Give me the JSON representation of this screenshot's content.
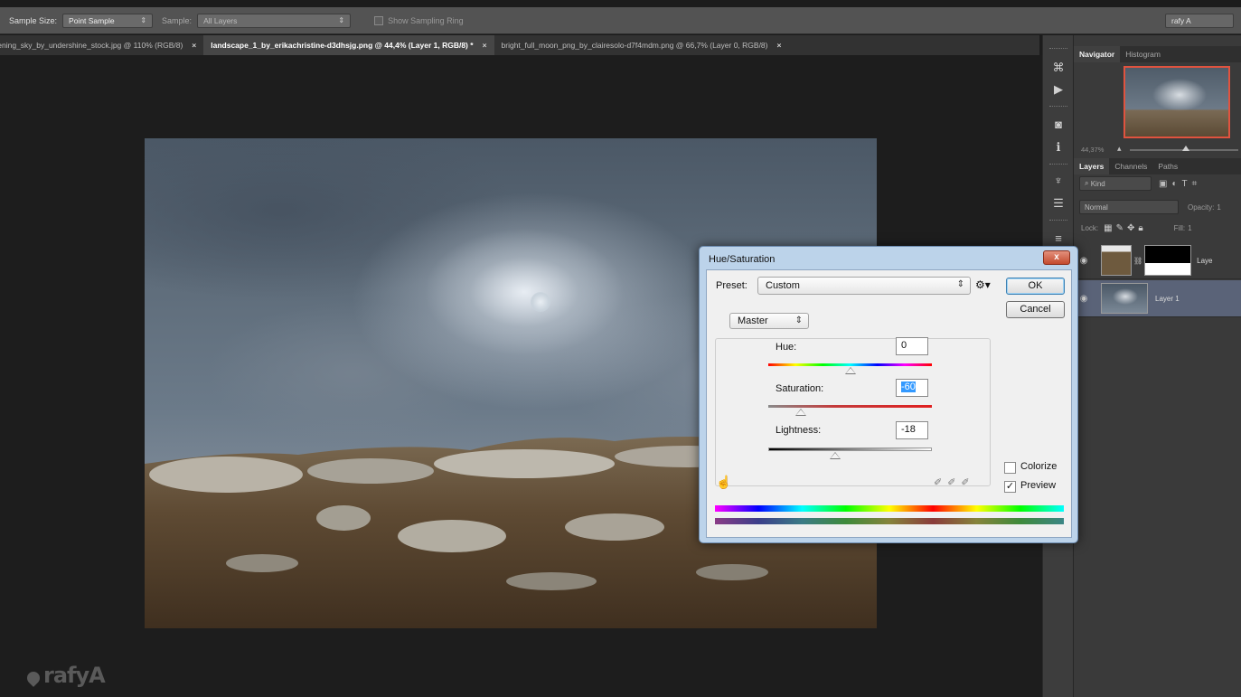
{
  "options_bar": {
    "sample_size_label": "Sample Size:",
    "sample_size_value": "Point Sample",
    "sample_label": "Sample:",
    "sample_value": "All Layers",
    "show_sampling_ring": "Show Sampling Ring",
    "user": "rafy A"
  },
  "tabs": [
    {
      "label": "vening_sky_by_undershine_stock.jpg @ 110% (RGB/8)",
      "close": "×"
    },
    {
      "label": "landscape_1_by_erikachristine-d3dhsjg.png @ 44,4% (Layer 1, RGB/8) *",
      "close": "×"
    },
    {
      "label": "bright_full_moon_png_by_clairesolo-d7f4mdm.png @ 66,7% (Layer 0, RGB/8)",
      "close": "×"
    }
  ],
  "watermark": "rafyA",
  "panels": {
    "navigator_tabs": [
      "Navigator",
      "Histogram"
    ],
    "zoom": "44,37%",
    "layers_tabs": [
      "Layers",
      "Channels",
      "Paths"
    ],
    "kind": "Kind",
    "blend_mode": "Normal",
    "opacity_label": "Opacity:",
    "opacity_value": "1",
    "lock_label": "Lock:",
    "fill_label": "Fill:",
    "fill_value": "1",
    "layers": [
      {
        "name": "Laye"
      },
      {
        "name": "Layer 1"
      }
    ]
  },
  "dialog": {
    "title": "Hue/Saturation",
    "close": "x",
    "preset_label": "Preset:",
    "preset_value": "Custom",
    "ok": "OK",
    "cancel": "Cancel",
    "channel": "Master",
    "hue_label": "Hue:",
    "hue_value": "0",
    "saturation_label": "Saturation:",
    "saturation_value": "-60",
    "lightness_label": "Lightness:",
    "lightness_value": "-18",
    "colorize_label": "Colorize",
    "colorize_checked": false,
    "preview_label": "Preview",
    "preview_checked": true,
    "check_mark": "✓",
    "hue_pos": 0.5,
    "saturation_pos": 0.2,
    "lightness_pos": 0.41
  },
  "colors": {
    "navigator_frame": "#e0533f",
    "selected_layer": "#5a6378",
    "dialog_frame": "#bcd3ea"
  },
  "icons": {
    "thumb": "triangle",
    "eye": "eye-icon",
    "hand": "hand-icon",
    "eyedroppers": [
      "eyedropper-icon",
      "eyedropper-plus-icon",
      "eyedropper-minus-icon"
    ]
  }
}
